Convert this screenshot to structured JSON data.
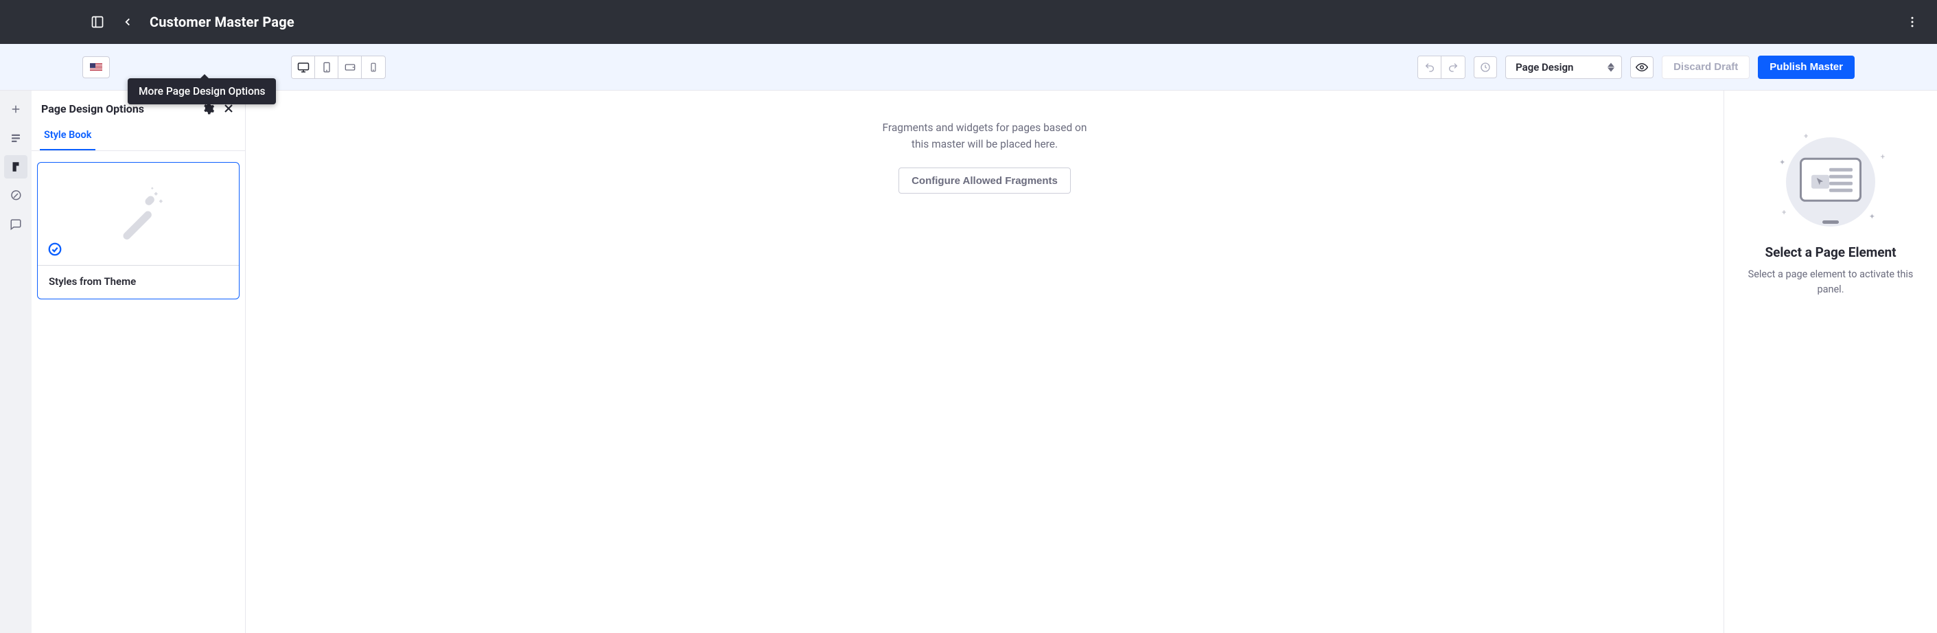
{
  "header": {
    "title": "Customer Master Page"
  },
  "toolbar": {
    "tooltip": "More Page Design Options",
    "mode_select": "Page Design",
    "discard": "Discard Draft",
    "publish": "Publish Master"
  },
  "left_panel": {
    "title": "Page Design Options",
    "tabs": [
      "Style Book"
    ],
    "card_label": "Styles from Theme"
  },
  "canvas": {
    "placeholder_line1": "Fragments and widgets for pages based on",
    "placeholder_line2": "this master will be placed here.",
    "configure_button": "Configure Allowed Fragments"
  },
  "right_panel": {
    "title": "Select a Page Element",
    "subtitle": "Select a page element to activate this panel."
  }
}
